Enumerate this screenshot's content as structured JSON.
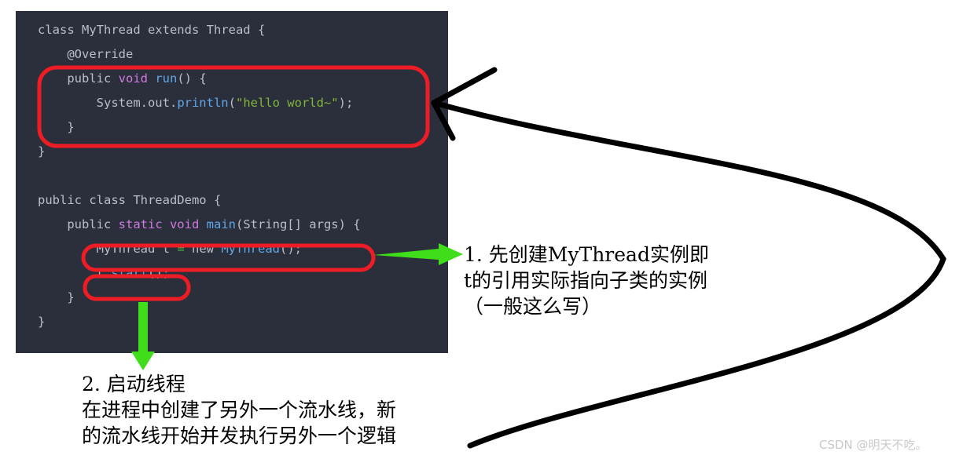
{
  "code": {
    "background": "#2b2f3b",
    "lines": [
      [
        {
          "t": "class MyThread extends Thread {",
          "c": "pl"
        }
      ],
      [
        {
          "t": "    @Override",
          "c": "pl"
        }
      ],
      [
        {
          "t": "    public ",
          "c": "pl"
        },
        {
          "t": "void",
          "c": "kw"
        },
        {
          "t": " ",
          "c": "pl"
        },
        {
          "t": "run",
          "c": "fn"
        },
        {
          "t": "() {",
          "c": "pl"
        }
      ],
      [
        {
          "t": "        System.out.",
          "c": "pl"
        },
        {
          "t": "println",
          "c": "fn"
        },
        {
          "t": "(",
          "c": "pl"
        },
        {
          "t": "\"hello world~\"",
          "c": "str"
        },
        {
          "t": ");",
          "c": "pl"
        }
      ],
      [
        {
          "t": "    }",
          "c": "pl"
        }
      ],
      [
        {
          "t": "}",
          "c": "pl"
        }
      ],
      [
        {
          "t": "",
          "c": "pl"
        }
      ],
      [
        {
          "t": "public class ThreadDemo {",
          "c": "pl"
        }
      ],
      [
        {
          "t": "    public ",
          "c": "pl"
        },
        {
          "t": "static void",
          "c": "kw"
        },
        {
          "t": " ",
          "c": "pl"
        },
        {
          "t": "main",
          "c": "fn"
        },
        {
          "t": "(String[] args) {",
          "c": "pl"
        }
      ],
      [
        {
          "t": "        MyThread t ",
          "c": "pl"
        },
        {
          "t": "=",
          "c": "op"
        },
        {
          "t": " new ",
          "c": "pl"
        },
        {
          "t": "MyThread",
          "c": "ty"
        },
        {
          "t": "();",
          "c": "pl"
        }
      ],
      [
        {
          "t": "        t.",
          "c": "pl"
        },
        {
          "t": "start",
          "c": "fn"
        },
        {
          "t": "();",
          "c": "pl"
        }
      ],
      [
        {
          "t": "    }",
          "c": "pl"
        }
      ],
      [
        {
          "t": "}",
          "c": "pl"
        }
      ]
    ]
  },
  "annotations": {
    "highlight_color": "#ee1c25",
    "arrow_green": "#3fdd1a",
    "arrow_black": "#000000",
    "note_1": "1. 先创建MyThread实例即\nt的引用实际指向子类的实例\n（一般这么写）",
    "note_2": "2. 启动线程\n在进程中创建了另外一个流水线，新\n的流水线开始并发执行另外一个逻辑"
  },
  "watermark": {
    "text": "CSDN @明天不吃。"
  }
}
